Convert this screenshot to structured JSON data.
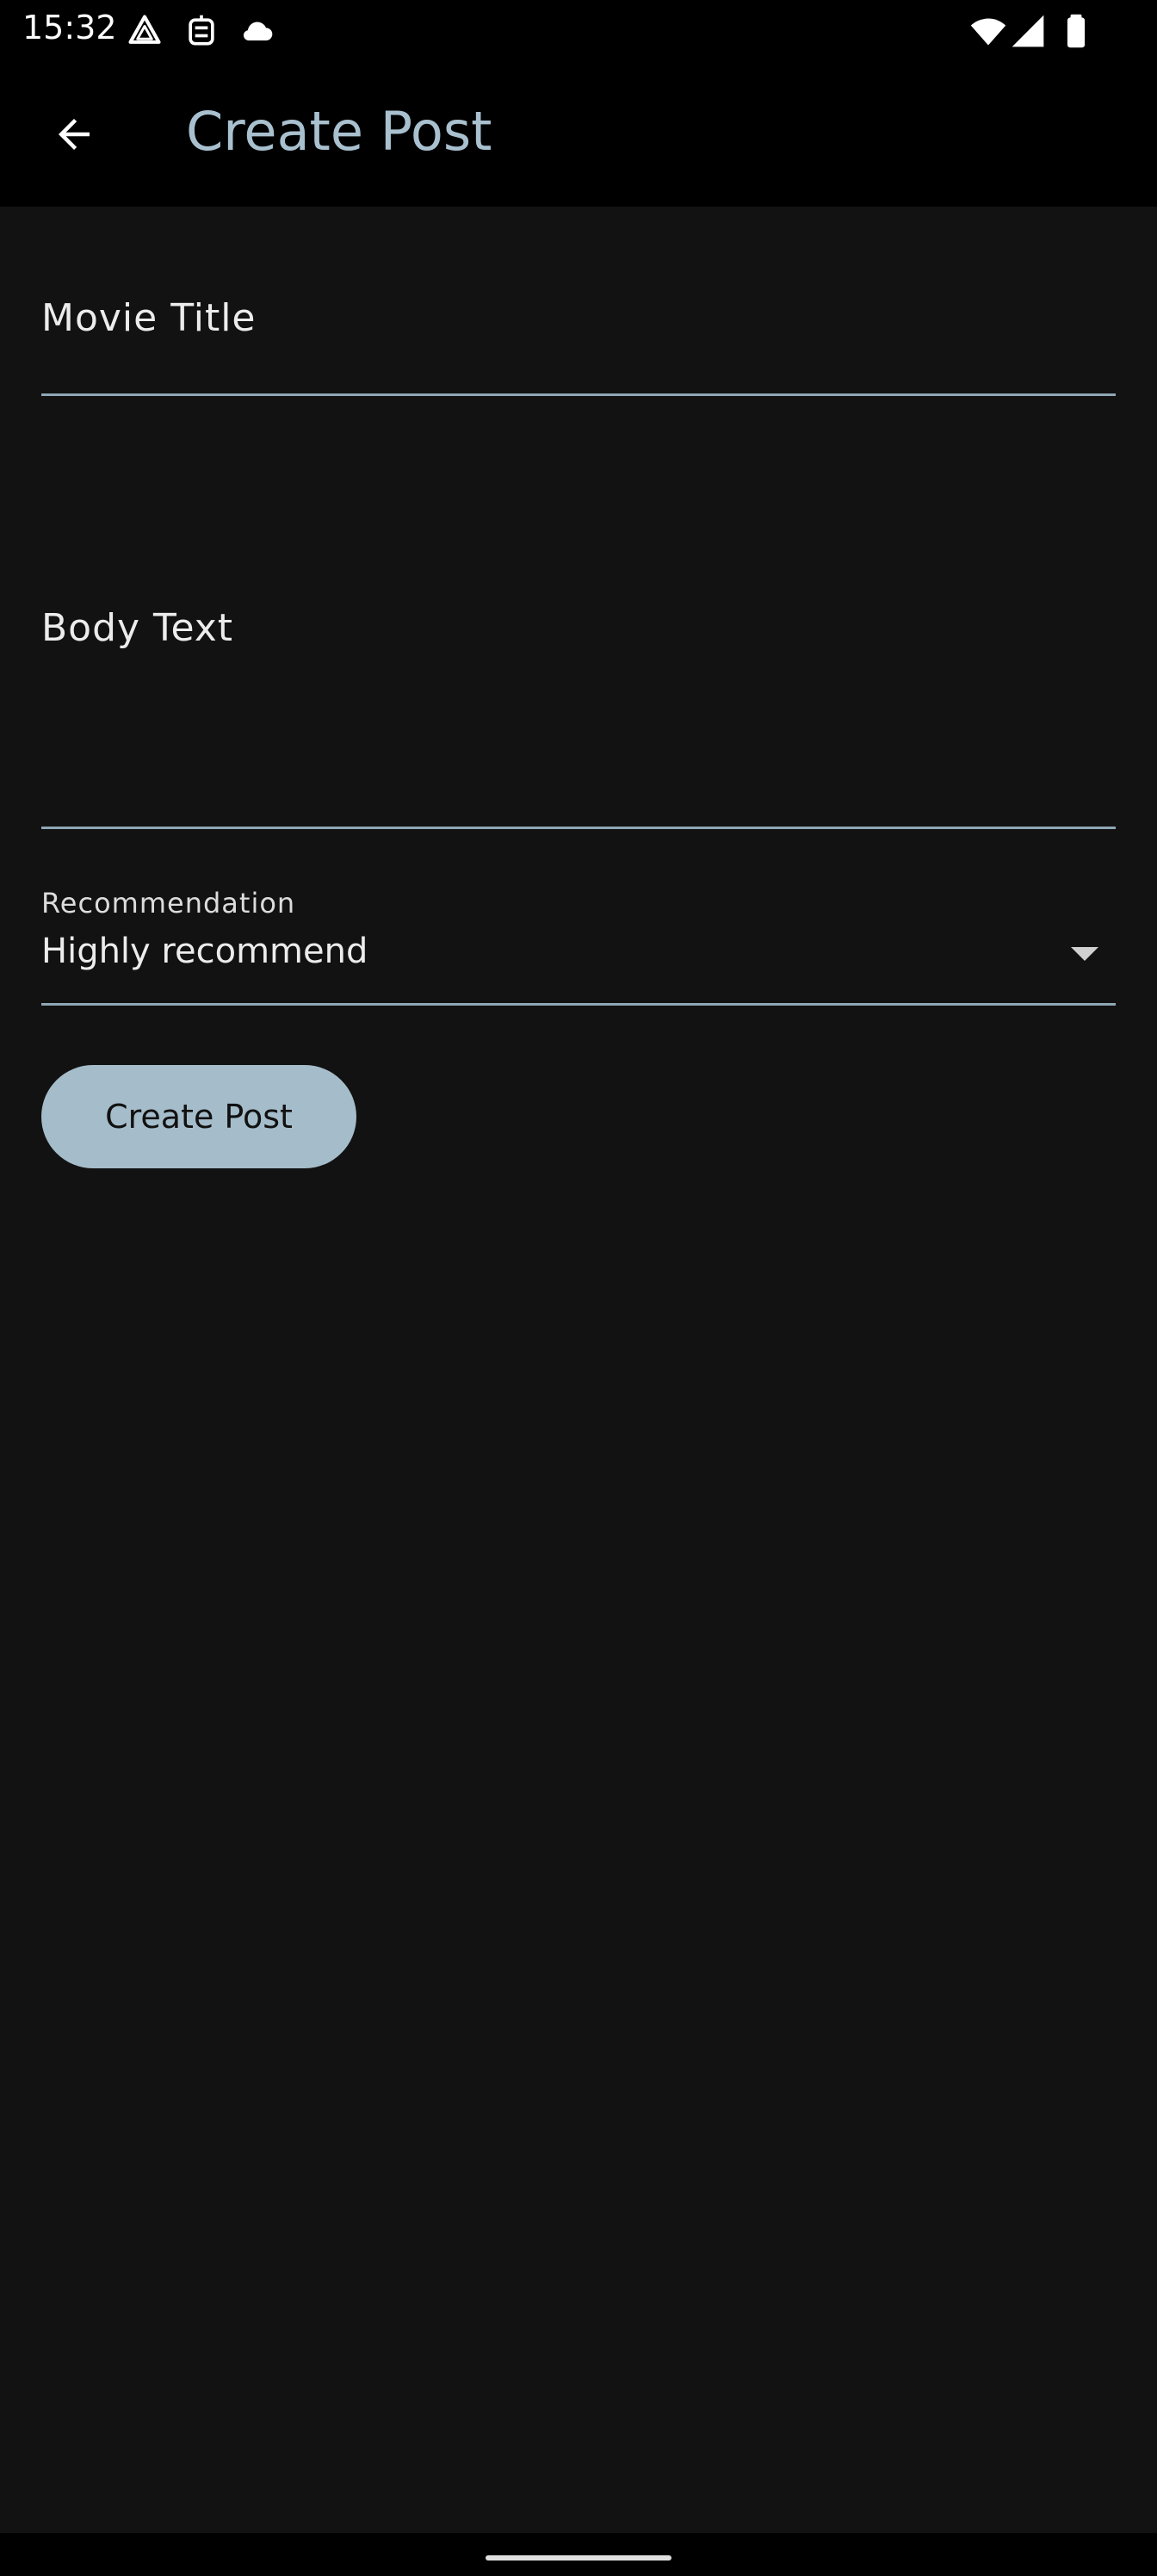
{
  "status_bar": {
    "time": "15:32",
    "left_icons": [
      "drive-icon",
      "bot-icon",
      "cloud-icon"
    ],
    "right_icons": [
      "wifi-icon",
      "signal-icon",
      "battery-icon"
    ]
  },
  "app_bar": {
    "title": "Create Post",
    "back_icon": "arrow-back-icon",
    "title_color": "#a9c0cf"
  },
  "form": {
    "movie_title": {
      "label": "Movie Title",
      "value": ""
    },
    "body_text": {
      "label": "Body Text",
      "value": ""
    },
    "recommendation": {
      "label": "Recommendation",
      "selected": "Highly recommend"
    },
    "submit_label": "Create Post"
  },
  "colors": {
    "background": "#121212",
    "accent": "#a5bdca",
    "underline": "#8fa7b5"
  }
}
